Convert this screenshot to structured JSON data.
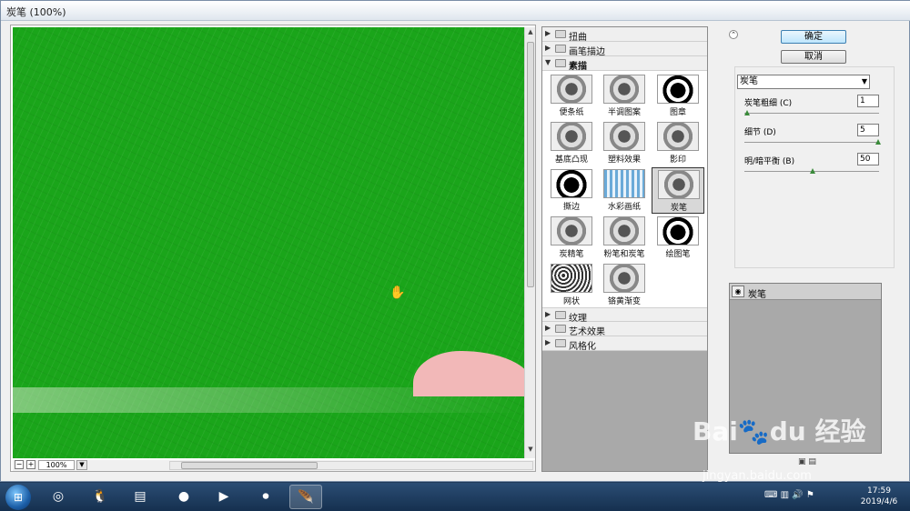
{
  "window": {
    "title": "炭笔 (100%)"
  },
  "preview": {
    "zoom": "100%",
    "zoom_out": "−",
    "zoom_in": "+"
  },
  "gallery": {
    "categories_top": [
      {
        "label": "扭曲",
        "expanded": false
      },
      {
        "label": "画笔描边",
        "expanded": false
      },
      {
        "label": "素描",
        "expanded": true
      }
    ],
    "filters": [
      {
        "label": "便条纸",
        "style": "gray"
      },
      {
        "label": "半调图案",
        "style": "gray"
      },
      {
        "label": "图章",
        "style": "dark"
      },
      {
        "label": "基底凸现",
        "style": "gray"
      },
      {
        "label": "塑料效果",
        "style": "gray"
      },
      {
        "label": "影印",
        "style": "gray"
      },
      {
        "label": "撕边",
        "style": "dark"
      },
      {
        "label": "水彩画纸",
        "style": "blue"
      },
      {
        "label": "炭笔",
        "style": "gray",
        "selected": true
      },
      {
        "label": "炭精笔",
        "style": "gray"
      },
      {
        "label": "粉笔和炭笔",
        "style": "gray"
      },
      {
        "label": "绘图笔",
        "style": "dark"
      },
      {
        "label": "网状",
        "style": "net"
      },
      {
        "label": "铬黄渐变",
        "style": "gray"
      }
    ],
    "categories_bottom": [
      {
        "label": "纹理"
      },
      {
        "label": "艺术效果"
      },
      {
        "label": "风格化"
      }
    ]
  },
  "panel": {
    "ok_label": "确定",
    "cancel_label": "取消",
    "filter_select": "炭笔",
    "params": [
      {
        "label": "炭笔粗细 (C)",
        "value": "1",
        "fraction": 0.0
      },
      {
        "label": "细节 (D)",
        "value": "5",
        "fraction": 1.0
      },
      {
        "label": "明/暗平衡 (B)",
        "value": "50",
        "fraction": 0.5
      }
    ],
    "layer_name": "炭笔"
  },
  "taskbar": {
    "time": "17:59",
    "date": "2019/4/6"
  },
  "watermark": {
    "brand": "Bai du 经验",
    "url": "jingyan.baidu.com"
  }
}
